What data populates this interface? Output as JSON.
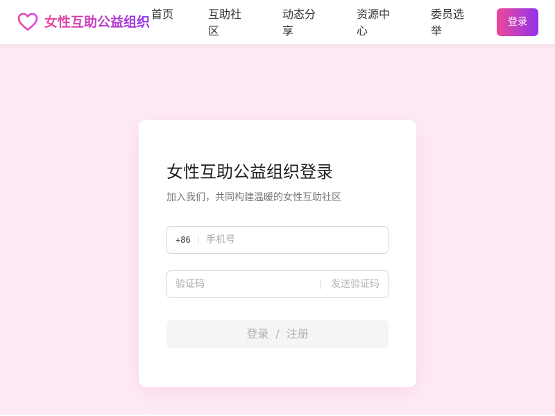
{
  "header": {
    "brand": "女性互助公益组织",
    "nav": [
      {
        "label": "首页"
      },
      {
        "label": "互助社区"
      },
      {
        "label": "动态分享"
      },
      {
        "label": "资源中心"
      },
      {
        "label": "委员选举"
      }
    ],
    "login_label": "登录",
    "logo_icon": "heart-icon",
    "accent_colors": [
      "#ec4899",
      "#9333ea"
    ]
  },
  "login_card": {
    "title": "女性互助公益组织登录",
    "subtitle": "加入我们，共同构建温暖的女性互助社区",
    "phone": {
      "prefix": "+86",
      "placeholder": "手机号",
      "value": ""
    },
    "code": {
      "placeholder": "验证码",
      "value": "",
      "send_label": "发送验证码"
    },
    "submit": {
      "login": "登录",
      "separator": "/",
      "register": "注册"
    }
  },
  "colors": {
    "page_background": "#fdeaf4",
    "card_background": "#ffffff"
  }
}
